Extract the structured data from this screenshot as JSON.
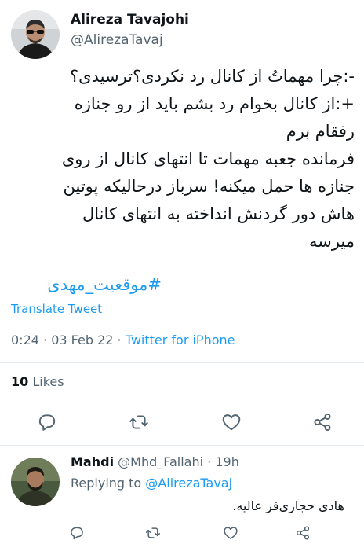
{
  "tweet": {
    "author_name": "Alireza Tavajohi",
    "author_handle": "@AlirezaTavaj",
    "lines": [
      "-:چرا مهماتُ از کانال رد نکردی؟ترسیدی؟",
      "+:از کانال بخوام رد بشم باید از رو جنازه",
      "رفقام برم",
      "فرمانده جعبه مهمات تا انتهای کانال از روی",
      "جنازه ها حمل میکنه! سرباز درحالیکه پوتین",
      "هاش دور گردنش انداخته به انتهای کانال",
      "میرسه"
    ],
    "hashtag": "#موقعیت_مهدی",
    "translate_label": "Translate Tweet",
    "time": "0:24",
    "date": "03 Feb 22",
    "source": "Twitter for iPhone",
    "likes_count": "10",
    "likes_label": "Likes"
  },
  "reply": {
    "author_name": "Mahdi",
    "author_handle": "@Mhd_Fallahi",
    "time": "19h",
    "replying_label": "Replying to",
    "replying_mention": "@AlirezaTavaj",
    "text": "هادی حجازی‌فر عالیه."
  },
  "icons": [
    "reply-icon",
    "retweet-icon",
    "like-icon",
    "share-icon"
  ],
  "colors": {
    "link": "#1d9bf0",
    "secondary": "#536471",
    "text": "#0f1419"
  }
}
